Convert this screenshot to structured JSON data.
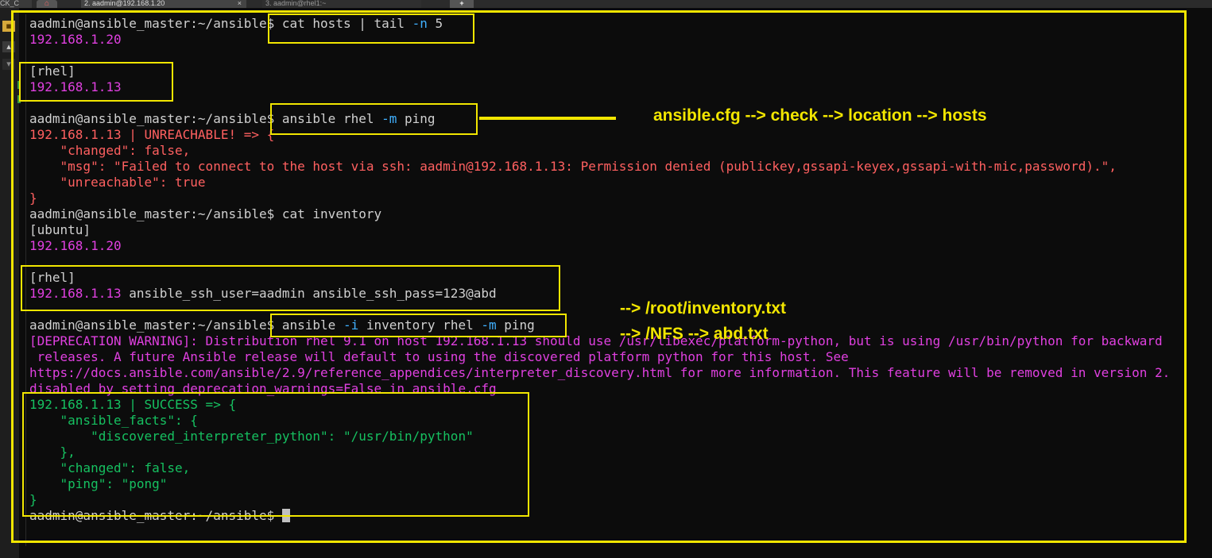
{
  "tabs": {
    "partial": "CK_C",
    "tab2": "2. aadmin@192.168.1.20",
    "tab3": "3. aadmin@rhel1:~",
    "close": "×",
    "add": "+"
  },
  "lines": [
    {
      "prompt": "aadmin@ansible_master:~/ansible$",
      "cmd_a": " cat hosts | tail ",
      "flag_a": "-n",
      "cmd_b": " 5"
    },
    {
      "text": "192.168.1.20"
    },
    {
      "text": "[rhel]"
    },
    {
      "text": "192.168.1.13"
    },
    {
      "prompt": "aadmin@ansible_master:~/ansible$",
      "cmd_a": " ansible rhel ",
      "flag_a": "-m",
      "cmd_b": " ping"
    },
    {
      "text": "192.168.1.13 | UNREACHABLE! => {"
    },
    {
      "text": "    \"changed\": false,"
    },
    {
      "text": "    \"msg\": \"Failed to connect to the host via ssh: aadmin@192.168.1.13: Permission denied (publickey,gssapi-keyex,gssapi-with-mic,password).\","
    },
    {
      "text": "    \"unreachable\": true"
    },
    {
      "text": "}"
    },
    {
      "prompt": "aadmin@ansible_master:~/ansible$",
      "cmd_a": " cat inventory"
    },
    {
      "text": "[ubuntu]"
    },
    {
      "text": "192.168.1.20"
    },
    {
      "text": "[rhel]"
    },
    {
      "host": "192.168.1.13",
      "rest": " ansible_ssh_user=aadmin ansible_ssh_pass=123@abd"
    },
    {
      "prompt": "aadmin@ansible_master:~/ansible$",
      "cmd_a": " ansible ",
      "flag_a": "-i",
      "cmd_b": " inventory rhel ",
      "flag_b": "-m",
      "cmd_c": " ping"
    },
    {
      "text": "[DEPRECATION WARNING]: Distribution rhel 9.1 on host 192.168.1.13 should use /usr/libexec/platform-python, but is using /usr/bin/python for backward"
    },
    {
      "text": " releases. A future Ansible release will default to using the discovered platform python for this host. See"
    },
    {
      "text": "https://docs.ansible.com/ansible/2.9/reference_appendices/interpreter_discovery.html for more information. This feature will be removed in version 2."
    },
    {
      "text": "disabled by setting deprecation_warnings=False in ansible.cfg"
    },
    {
      "text": "192.168.1.13 | SUCCESS => {"
    },
    {
      "text": "    \"ansible_facts\": {"
    },
    {
      "text": "        \"discovered_interpreter_python\": \"/usr/bin/python\""
    },
    {
      "text": "    },"
    },
    {
      "text": "    \"changed\": false,"
    },
    {
      "text": "    \"ping\": \"pong\""
    },
    {
      "text": "}"
    },
    {
      "prompt": "aadmin@ansible_master:~/ansible$",
      "cmd_a": " "
    }
  ],
  "annotations": {
    "note1": "ansible.cfg --> check --> location --> hosts",
    "note2": "--> /root/inventory.txt",
    "note3": "--> /NFS --> abd.txt"
  },
  "colors": {
    "background": "#0c0c0c",
    "text": "#d0d0d0",
    "magenta": "#e040e0",
    "error": "#ff6060",
    "success": "#16c060",
    "flag": "#40b0ff",
    "annotation": "#f2e600"
  }
}
